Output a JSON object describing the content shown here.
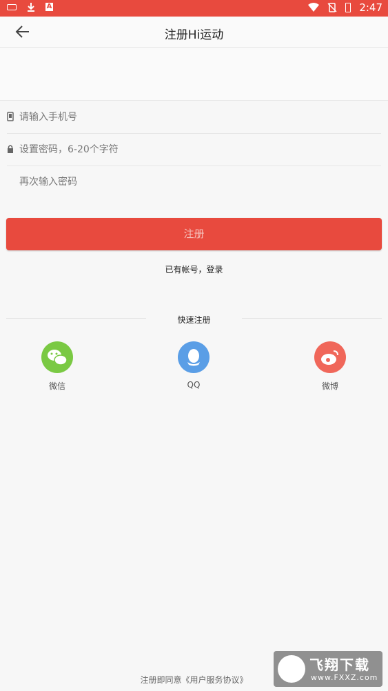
{
  "status_bar": {
    "time": "2:47",
    "bg_color": "#e84a3e",
    "icons": [
      "keyboard-icon",
      "download-icon",
      "app-a-icon",
      "wifi-icon",
      "no-sim-icon",
      "battery-icon"
    ]
  },
  "header": {
    "title": "注册Hi运动",
    "back_icon": "arrow-left-icon"
  },
  "form": {
    "phone_placeholder": "请输入手机号",
    "phone_value": "",
    "password_placeholder": "设置密码，6-20个字符",
    "password_value": "",
    "confirm_placeholder": "再次输入密码",
    "confirm_value": ""
  },
  "register_button": "注册",
  "login_link": "已有帐号，登录",
  "quick_register": {
    "label": "快速注册",
    "options": [
      {
        "label": "微信",
        "color": "#7ac943",
        "icon": "wechat-icon"
      },
      {
        "label": "QQ",
        "color": "#5a9ee6",
        "icon": "qq-icon"
      },
      {
        "label": "微博",
        "color": "#f0675a",
        "icon": "weibo-icon"
      }
    ]
  },
  "agreement": "注册即同意《用户服务协议》",
  "watermark": {
    "title": "飞翔下载",
    "url": "www.FXXZ.com"
  },
  "colors": {
    "accent": "#e84a3e",
    "background": "#f7f7f7"
  }
}
